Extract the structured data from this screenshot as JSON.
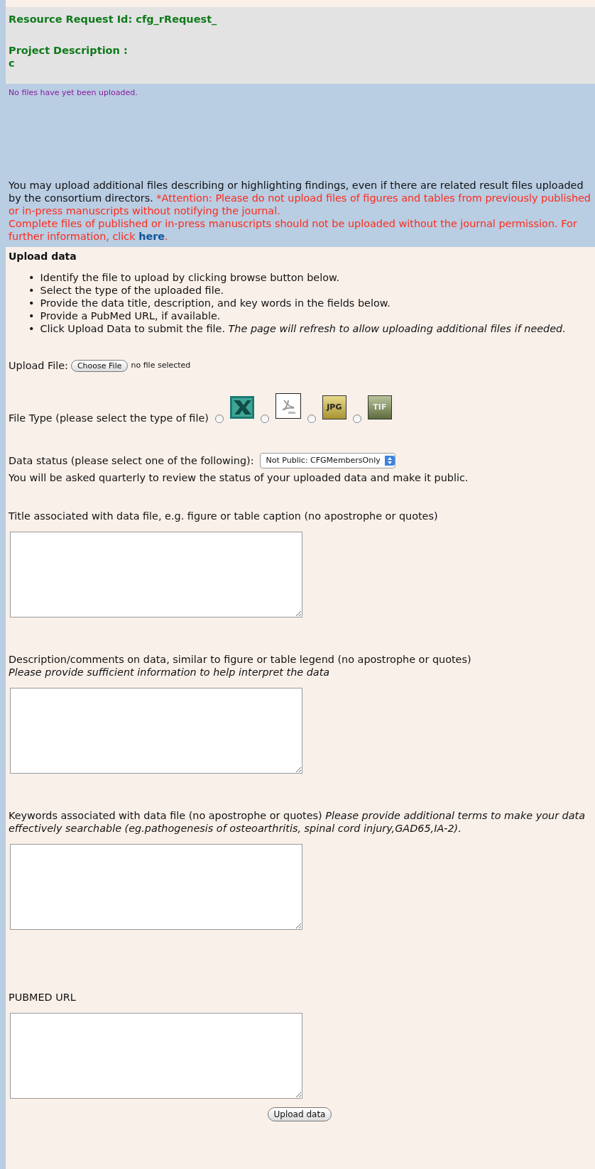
{
  "header": {
    "request_id": "Resource Request Id: cfg_rRequest_",
    "project_description_label": "Project Description :",
    "project_description_value": "c"
  },
  "files_notice": "No files have yet been uploaded.",
  "upload_notice": {
    "intro": "You may upload additional files describing or highlighting findings, even if there are related result files uploaded by the consortium directors.",
    "attention": "*Attention: Please do not upload files of figures and tables from previously published or in-press manuscripts without notifying the journal.",
    "warning": "Complete files of published or in-press manuscripts should not be uploaded without the journal permission. For further information, click",
    "link": "here",
    "end": "."
  },
  "upload_section": {
    "title": "Upload data",
    "bullet": "•",
    "instructions": [
      "Identify the file to upload by clicking browse button below.",
      "Select the type of the uploaded file.",
      "Provide the data title, description, and key words in the fields below.",
      "Provide a PubMed URL, if available.",
      "Click Upload Data to submit the file. *The page will refresh to allow uploading additional files if needed.*"
    ],
    "upload_file": {
      "label": "Upload File:",
      "button": "Choose File",
      "status": "no file selected"
    },
    "file_type": {
      "label": "File Type (please select the type of file)",
      "options": [
        {
          "kind": "xls",
          "selected": false
        },
        {
          "kind": "pdf",
          "selected": false
        },
        {
          "kind": "jpg",
          "label": "JPG",
          "selected": false
        },
        {
          "kind": "tif",
          "label": "TIF",
          "selected": false
        }
      ]
    },
    "data_status": {
      "label": "Data status (please select one of the following):",
      "value": "Not Public: CFGMembersOnly"
    },
    "review_note": "You will be asked quarterly to review the status of your uploaded data and make it public.",
    "fields": [
      {
        "label": "Title associated with data file, e.g. figure or table caption (no apostrophe or quotes)"
      },
      {
        "label": "Description/comments on data, similar to figure or table legend (no apostrophe or quotes)",
        "hint": "Please provide sufficient information to help interpret the data"
      },
      {
        "label": "Keywords associated with data file (no apostrophe or quotes) *Please provide additional terms to make your data effectively searchable (eg.pathogenesis of osteoarthritis, spinal cord injury,GAD65,IA-2).*"
      },
      {
        "label": "PUBMED URL"
      }
    ],
    "submit": "Upload data"
  }
}
